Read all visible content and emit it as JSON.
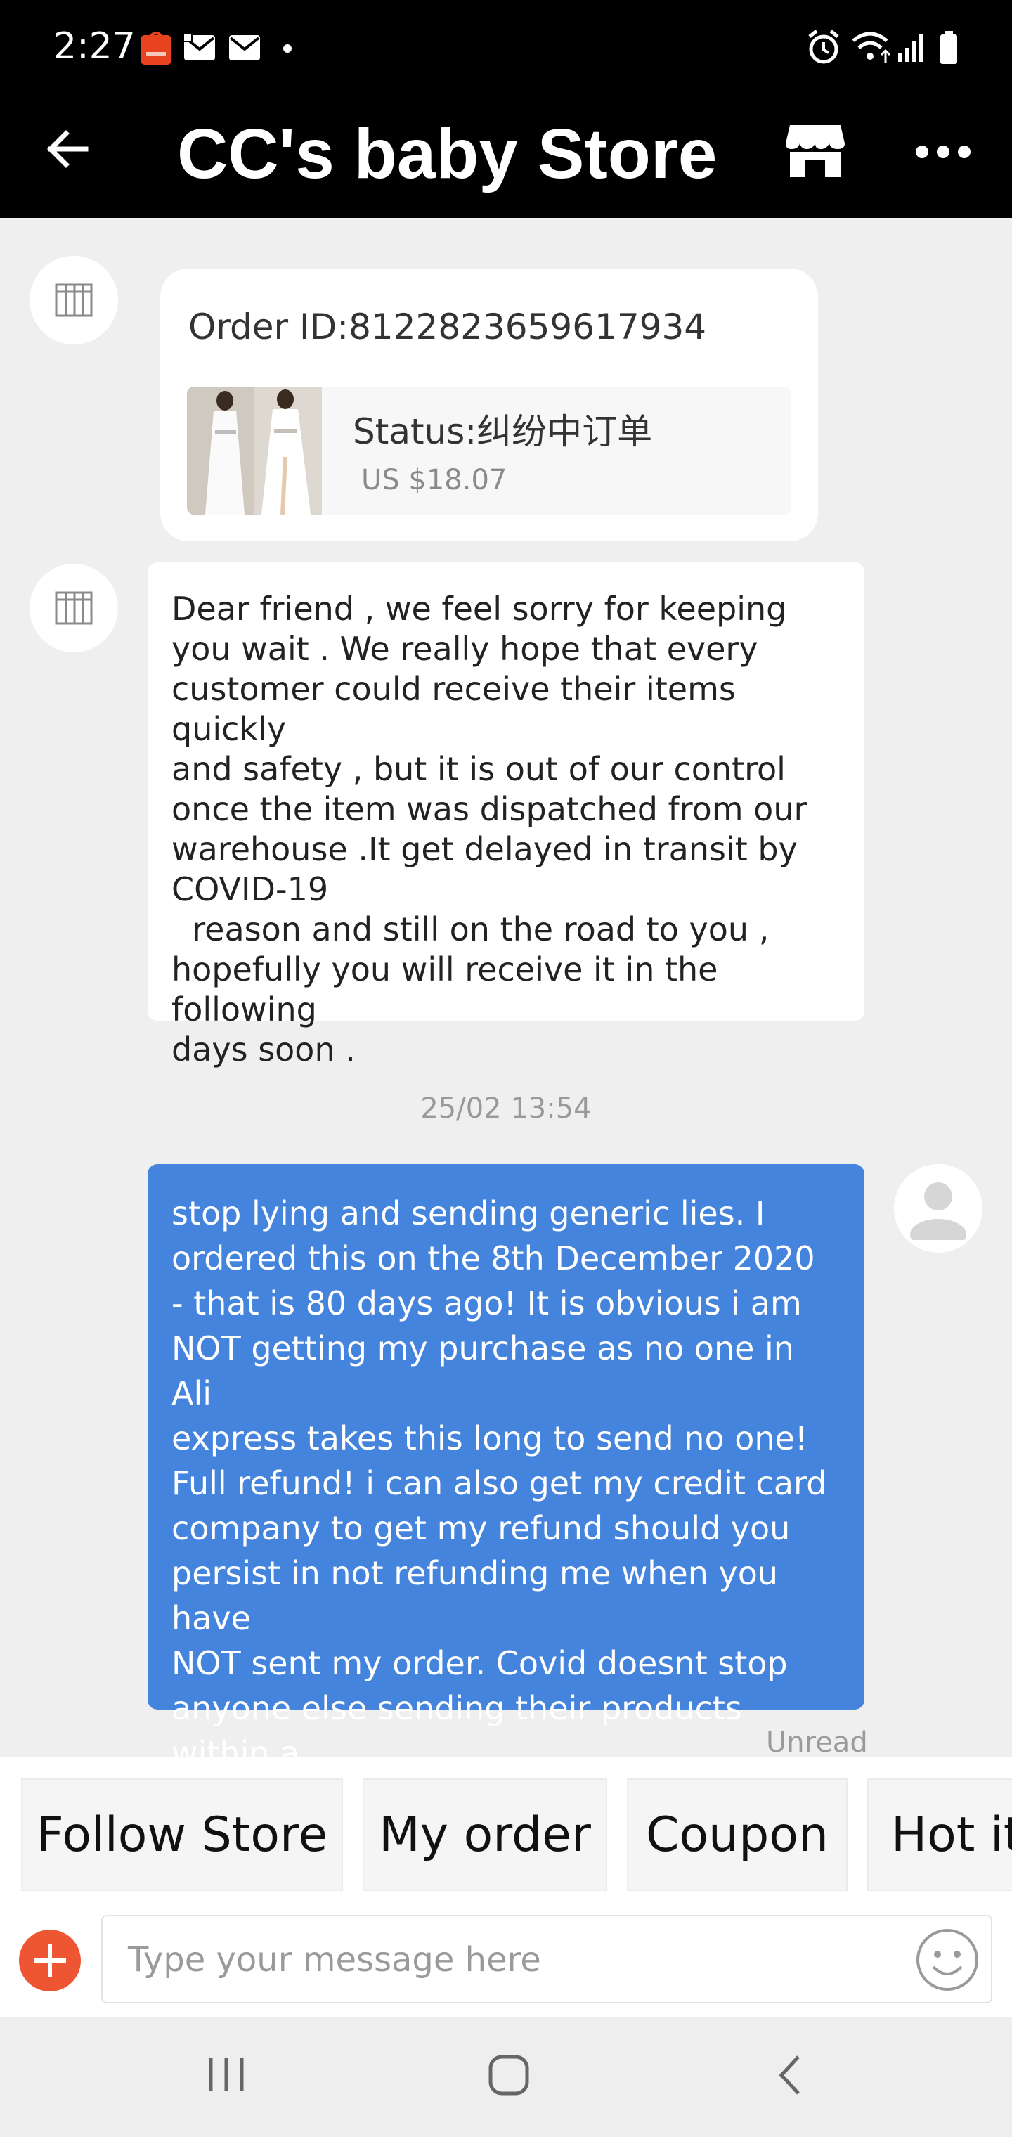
{
  "status_bar": {
    "time": "2:27"
  },
  "header": {
    "title": "CC's baby Store"
  },
  "order_card": {
    "order_id": "Order ID:8122823659617934",
    "status": "Status:纠纷中订单",
    "price": "US $18.07"
  },
  "messages": [
    {
      "from": "store",
      "text": "Dear friend , we feel sorry for keeping\nyou wait . We really hope that every\ncustomer could receive their items quickly\nand safety , but it is out of our control\nonce the item was dispatched from our\nwarehouse .It get delayed in transit by\nCOVID-19\n  reason and still on the road to you ,\nhopefully you will receive it in the following\ndays soon ."
    },
    {
      "from": "me",
      "timestamp": "25/02 13:54",
      "text": "stop lying and sending generic lies. I\nordered this on the 8th December 2020\n- that is 80 days ago! It is obvious i am\nNOT getting my purchase as no one in Ali\nexpress takes this long to send no one!\nFull refund! i can also get my credit card\ncompany to get my refund should you\npersist in not refunding me when you have\nNOT sent my order. Covid doesnt stop\nanyone else sending their products within a\nreasonable timeframe.",
      "read_status": "Unread"
    }
  ],
  "quick_actions": [
    "Follow Store",
    "My order",
    "Coupon",
    "Hot it"
  ],
  "composer": {
    "placeholder": "Type your message here"
  },
  "colors": {
    "accent_blue": "#4584dc",
    "add_button": "#ee5533",
    "header_bg": "#000000"
  }
}
